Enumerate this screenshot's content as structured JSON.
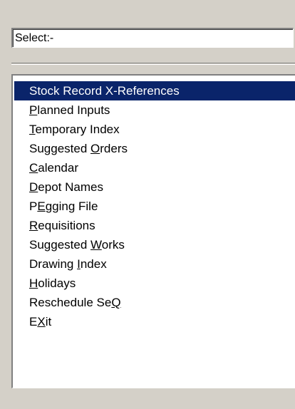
{
  "select_field": {
    "value": "Select:-"
  },
  "menu": {
    "selected_index": 0,
    "items": [
      {
        "label": "Stock Record X-References",
        "hotkey_index": -1,
        "name": "stock-record-x-references"
      },
      {
        "label": "Planned Inputs",
        "hotkey_index": 0,
        "name": "planned-inputs"
      },
      {
        "label": "Temporary Index",
        "hotkey_index": 0,
        "name": "temporary-index"
      },
      {
        "label": "Suggested Orders",
        "hotkey_index": 10,
        "name": "suggested-orders"
      },
      {
        "label": "Calendar",
        "hotkey_index": 0,
        "name": "calendar"
      },
      {
        "label": "Depot Names",
        "hotkey_index": 0,
        "name": "depot-names"
      },
      {
        "label": "PEgging File",
        "hotkey_index": 1,
        "name": "pegging-file"
      },
      {
        "label": "Requisitions",
        "hotkey_index": 0,
        "name": "requisitions"
      },
      {
        "label": "Suggested Works",
        "hotkey_index": 10,
        "name": "suggested-works"
      },
      {
        "label": "Drawing Index",
        "hotkey_index": 8,
        "name": "drawing-index"
      },
      {
        "label": "Holidays",
        "hotkey_index": 0,
        "name": "holidays"
      },
      {
        "label": "Reschedule SeQ",
        "hotkey_index": 13,
        "name": "reschedule-seq"
      },
      {
        "label": "EXit",
        "hotkey_index": 1,
        "name": "exit"
      }
    ]
  },
  "colors": {
    "window_bg": "#d4d0c8",
    "selection_bg": "#0a246a",
    "selection_text": "#ffffff",
    "text": "#000000"
  }
}
